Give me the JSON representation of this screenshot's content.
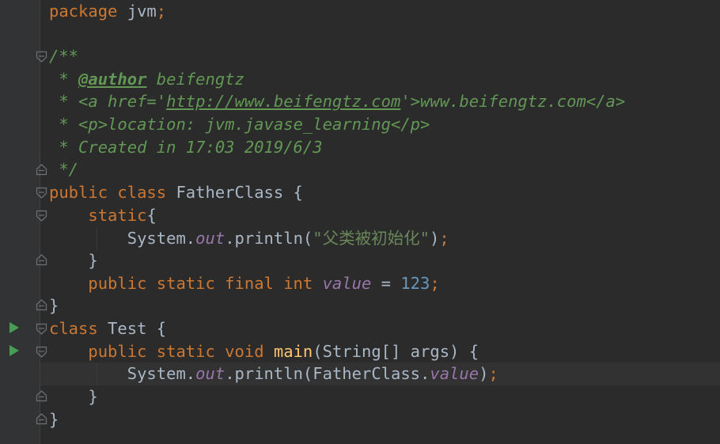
{
  "code": {
    "l1": {
      "kw": "package",
      "rest": " jvm",
      "semi": ";"
    },
    "l2": {
      "open": "/**"
    },
    "l3": {
      "lead": " * ",
      "tag": "@author",
      "text": " beifengtz"
    },
    "l4": {
      "lead": " * <a href='",
      "url": "http://www.beifengtz.com",
      "tail": "'>www.beifengtz.com</a>"
    },
    "l5": {
      "text": " * <p>location: jvm.javase_learning</p>"
    },
    "l6": {
      "text": " * Created in 17:03 2019/6/3"
    },
    "l7": {
      "text": " */"
    },
    "l8": {
      "kw": "public class",
      "rest": " FatherClass {"
    },
    "l9": {
      "indent": "    ",
      "kw": "static",
      "rest": "{"
    },
    "l10": {
      "indent": "        ",
      "obj": "System.",
      "fld": "out",
      "call": ".println(",
      "str": "\"父类被初始化\"",
      "close": ")",
      "semi": ";"
    },
    "l11": {
      "text": "    }"
    },
    "l12": {
      "indent": "    ",
      "kw": "public static final int",
      "sp": " ",
      "fld": "value",
      "eq": " = ",
      "num": "123",
      "semi": ";"
    },
    "l13": {
      "text": "}"
    },
    "l14": {
      "kw": "class",
      "rest": " Test {"
    },
    "l15": {
      "indent": "    ",
      "kw": "public static void",
      "sp": " ",
      "fn": "main",
      "rest": "(String[] args) {"
    },
    "l16": {
      "indent": "        ",
      "obj": "System.",
      "fld": "out",
      "call": ".println(FatherClass.",
      "fld2": "value",
      "close": ")",
      "semi": ";"
    },
    "l17": {
      "text": "    }"
    },
    "l18": {
      "text": "}"
    }
  },
  "icons": {
    "run": "run-arrow-icon",
    "fold": "fold-marker-icon"
  },
  "colors": {
    "background": "#2b2b2b",
    "gutter": "#313335",
    "keyword": "#cc7832",
    "comment": "#629755",
    "string": "#6a8759",
    "field": "#9876aa",
    "number": "#6897bb",
    "method": "#ffc66d",
    "text": "#a9b7c6",
    "run": "#499c54"
  }
}
